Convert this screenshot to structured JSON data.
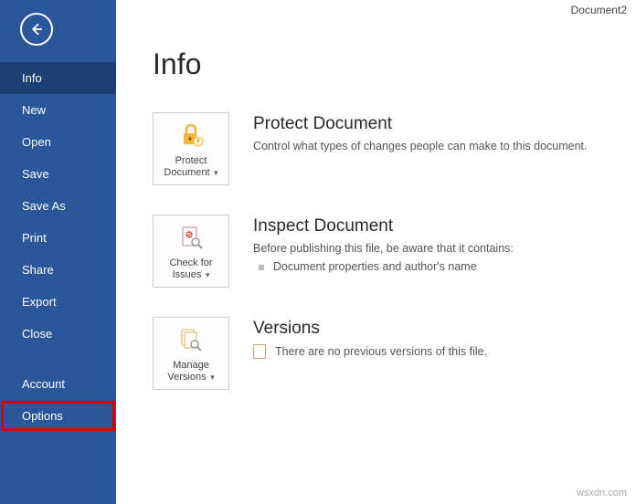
{
  "document_title": "Document2",
  "sidebar": {
    "items": [
      {
        "label": "Info",
        "active": true
      },
      {
        "label": "New"
      },
      {
        "label": "Open"
      },
      {
        "label": "Save"
      },
      {
        "label": "Save As"
      },
      {
        "label": "Print"
      },
      {
        "label": "Share"
      },
      {
        "label": "Export"
      },
      {
        "label": "Close"
      },
      {
        "label": "Account"
      },
      {
        "label": "Options",
        "highlight": true
      }
    ]
  },
  "page_heading": "Info",
  "protect": {
    "tile_line1": "Protect",
    "tile_line2": "Document",
    "title": "Protect Document",
    "desc": "Control what types of changes people can make to this document."
  },
  "inspect": {
    "tile_line1": "Check for",
    "tile_line2": "Issues",
    "title": "Inspect Document",
    "desc": "Before publishing this file, be aware that it contains:",
    "bullet": "Document properties and author's name"
  },
  "versions": {
    "tile_line1": "Manage",
    "tile_line2": "Versions",
    "title": "Versions",
    "desc": "There are no previous versions of this file."
  },
  "watermark": "wsxdn.com"
}
